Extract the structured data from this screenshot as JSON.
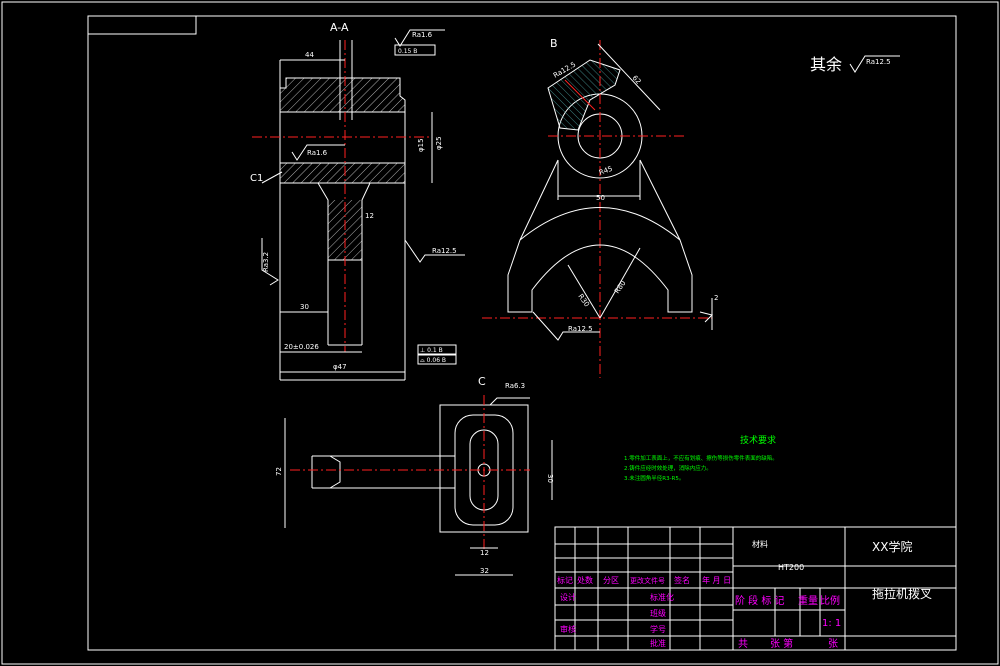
{
  "views": {
    "section_aa": "A-A",
    "view_b": "B",
    "view_c": "C",
    "c1_label": "C1"
  },
  "general_roughness": {
    "label": "其余",
    "value": "Ra12.5"
  },
  "roughness": {
    "top": "Ra1.6",
    "mid": "Ra1.6",
    "side": "Ra3.2",
    "right": "Ra12.5",
    "b_top": "Ra12.5",
    "b_bottom": "Ra12.5",
    "c_top": "Ra6.3"
  },
  "dimensions": {
    "d44": "44",
    "d30": "30",
    "d20": "20±0.026",
    "d_phi15": "φ15",
    "d_phi25": "φ25",
    "d_ref": "φ25",
    "d_bottom": "φ47",
    "d2": "2",
    "d_r12": "12",
    "d_50": "50",
    "d_r30": "R30",
    "d_r80": "R80",
    "d_r45": "R45",
    "d_62": "62",
    "d_72": "72",
    "d_30c": "30",
    "d_12c": "12",
    "d_32c": "32"
  },
  "tolerance_frames": {
    "top": "0.15 B",
    "bottom_1": "⊥ 0.1 B",
    "bottom_2": "⌓ 0.06 B"
  },
  "technical_requirements": {
    "title": "技术要求",
    "items": [
      "1.零件加工表面上，不应有划痕、擦伤等损伤零件表面的缺陷。",
      "2.铸件应经时效处理，消除内应力。",
      "3.未注圆角半径R3-R5。"
    ]
  },
  "title_block": {
    "material_label": "材料",
    "material": "HT200",
    "school": "XX学院",
    "part_name": "拖拉机拨叉",
    "revision_headers": [
      "标记",
      "处数",
      "分区",
      "更改文件号",
      "签名",
      "年 月 日"
    ],
    "rows": [
      "设计",
      "审核"
    ],
    "right_labels": [
      "标准化",
      "班级",
      "学号",
      "批准"
    ],
    "stage_labels": [
      "阶 段 标 记",
      "重量",
      "比例"
    ],
    "scale": "1: 1",
    "sheet_labels": [
      "共",
      "张 第",
      "张"
    ]
  },
  "colors": {
    "background": "#000000",
    "lines": "#ffffff",
    "centerlines": "#ff2020",
    "title_text": "#ff00ff",
    "notes_text": "#00ff00"
  }
}
